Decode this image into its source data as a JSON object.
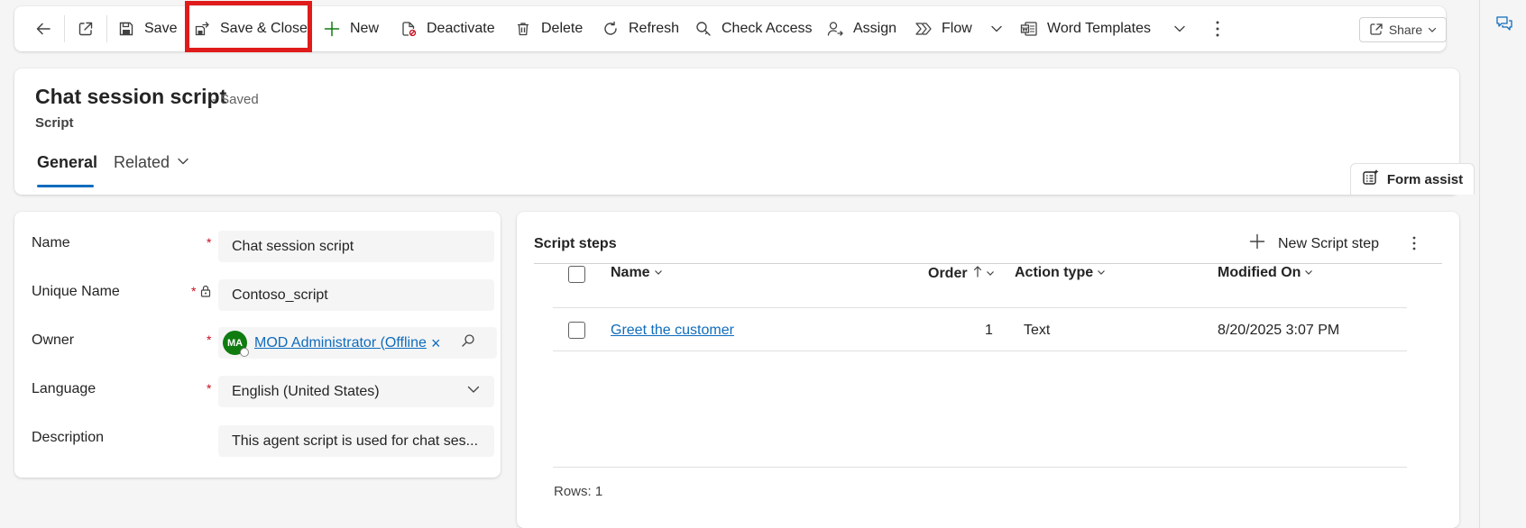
{
  "toolbar": {
    "back": "Back",
    "open_new_window": "Open in new window",
    "save": "Save",
    "save_close": "Save & Close",
    "new": "New",
    "deactivate": "Deactivate",
    "delete": "Delete",
    "refresh": "Refresh",
    "check_access": "Check Access",
    "assign": "Assign",
    "flow": "Flow",
    "word_templates": "Word Templates",
    "share": "Share"
  },
  "header": {
    "title": "Chat session script",
    "status": "- Saved",
    "entity": "Script",
    "tabs": [
      {
        "label": "General",
        "active": true
      },
      {
        "label": "Related",
        "active": false
      }
    ],
    "form_assist": "Form assist"
  },
  "form": {
    "fields": [
      {
        "label": "Name",
        "value": "Chat session script",
        "required": true
      },
      {
        "label": "Unique Name",
        "value": "Contoso_script",
        "required": true,
        "locked": true
      },
      {
        "label": "Owner",
        "value": "MOD Administrator (Offline",
        "initials": "MA",
        "required": true
      },
      {
        "label": "Language",
        "value": "English (United States)",
        "required": true
      },
      {
        "label": "Description",
        "value": "This agent script is used for chat ses...",
        "required": false
      }
    ]
  },
  "grid": {
    "title": "Script steps",
    "new_button": "New Script step",
    "columns": [
      "Name",
      "Order",
      "Action type",
      "Modified On"
    ],
    "rows": [
      {
        "name": "Greet the customer",
        "order": "1",
        "action_type": "Text",
        "modified_on": "8/20/2025 3:07 PM"
      }
    ],
    "rows_label": "Rows: 1"
  },
  "colors": {
    "accent": "#0f6cbd",
    "highlight": "#e01b1b",
    "required": "#c50f1f",
    "avatar": "#107c10"
  }
}
